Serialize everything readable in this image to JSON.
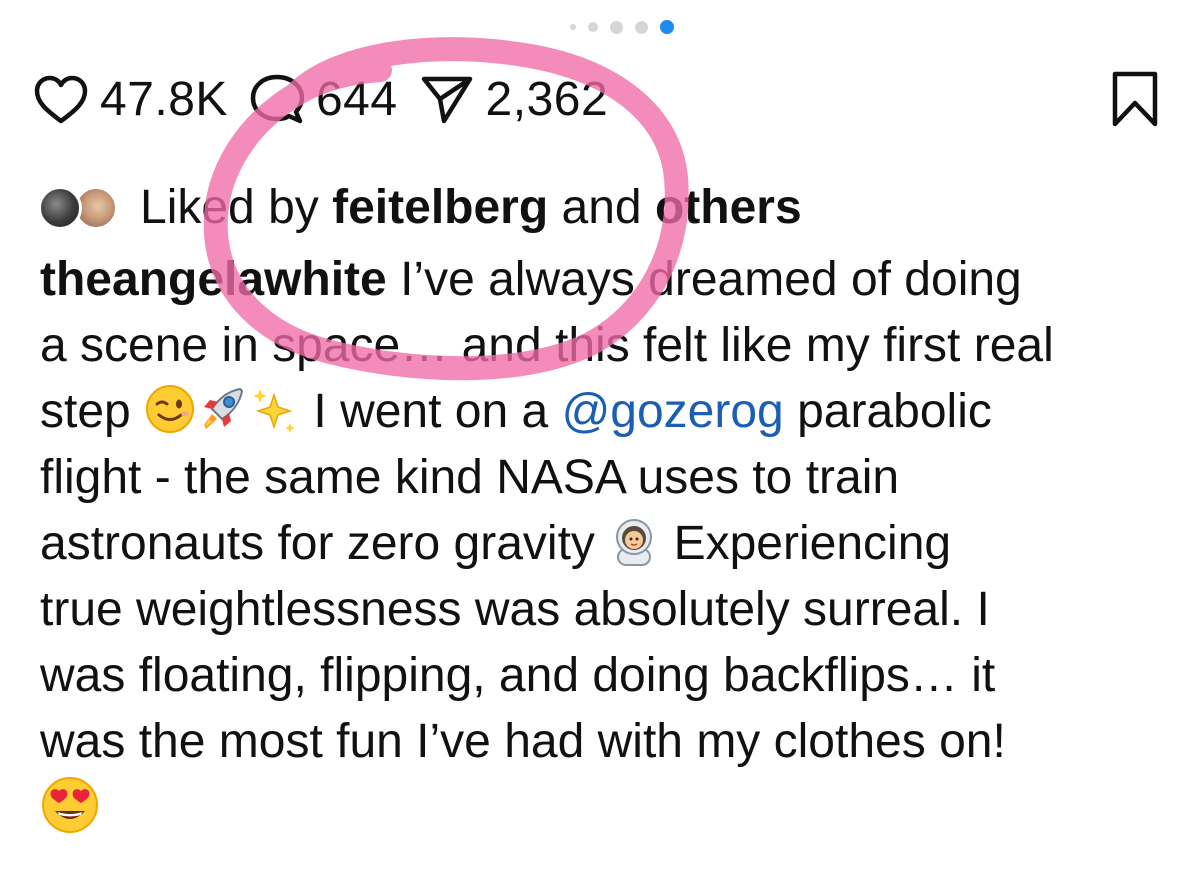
{
  "carousel": {
    "dot_count": 5,
    "active_index": 4,
    "active_color": "#1d8cf0",
    "inactive_color": "#d6d6d6"
  },
  "actions": {
    "likes": "47.8K",
    "comments": "644",
    "shares": "2,362"
  },
  "liked_by": {
    "prefix": "Liked by ",
    "user": "feitelberg",
    "middle": " and ",
    "others": "others"
  },
  "caption": {
    "username": "theangelawhite",
    "mention": "@gozerog",
    "lines": {
      "l1": " I’ve always dreamed of doing",
      "l2": "a scene in space… and this felt like my first real",
      "l3a": "step ",
      "l3b": " I went on a ",
      "l3c": " parabolic",
      "l4": "flight - the same kind NASA uses to train",
      "l5a": "astronauts for zero gravity ",
      "l5b": " Experiencing",
      "l6": "true weightlessness was absolutely surreal. I",
      "l7": "was floating, flipping, and doing backflips… it",
      "l8": "was the most fun I’ve had with my clothes on!"
    },
    "emojis": [
      "winking-face",
      "rocket",
      "sparkles",
      "astronaut",
      "heart-eyes-face"
    ]
  },
  "annotation_color": "#f06aa8",
  "text_color": "#111111",
  "link_color": "#1a5fb4"
}
